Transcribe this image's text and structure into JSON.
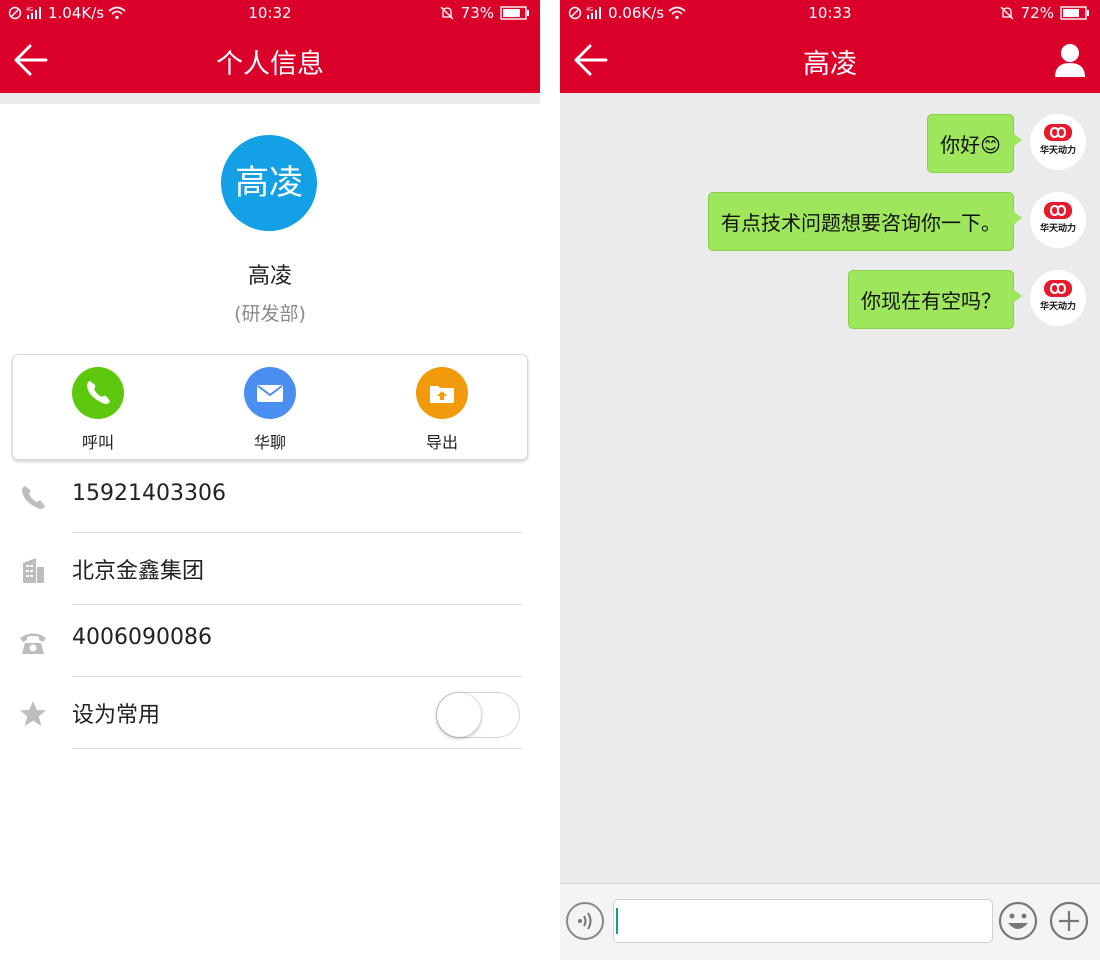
{
  "left": {
    "status": {
      "speed": "1.04K/s",
      "time": "10:32",
      "battery": "73%"
    },
    "nav": {
      "title": "个人信息"
    },
    "profile": {
      "avatar_text": "高凌",
      "name": "高凌",
      "dept": "(研发部)"
    },
    "actions": [
      {
        "label": "呼叫",
        "color": "#5ec80e"
      },
      {
        "label": "华聊",
        "color": "#4a8ef0"
      },
      {
        "label": "导出",
        "color": "#f19a0c"
      }
    ],
    "details": {
      "phone": "15921403306",
      "company": "北京金鑫集团",
      "tel": "4006090086",
      "favorite_label": "设为常用"
    }
  },
  "right": {
    "status": {
      "speed": "0.06K/s",
      "time": "10:33",
      "battery": "72%"
    },
    "nav": {
      "title": "高凌"
    },
    "messages": [
      {
        "text": "你好",
        "emoji": "😊"
      },
      {
        "text": "有点技术问题想要咨询你一下。"
      },
      {
        "text": "你现在有空吗？"
      }
    ],
    "logo": {
      "line1": "华天动力"
    }
  },
  "colors": {
    "brand_red": "#db0029",
    "bubble_green": "#9ee75c",
    "avatar_blue": "#13a0e4"
  }
}
